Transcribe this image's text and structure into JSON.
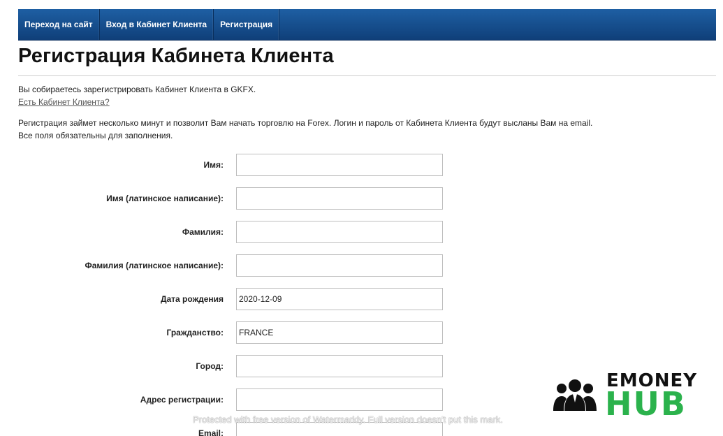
{
  "nav": {
    "items": [
      {
        "label": "Переход на сайт"
      },
      {
        "label": "Вход в Кабинет Клиента"
      },
      {
        "label": "Регистрация"
      }
    ]
  },
  "page": {
    "title": "Регистрация Кабинета Клиента",
    "intro": "Вы собираетесь зарегистрировать Кабинет Клиента в GKFX.",
    "have_account_link": "Есть Кабинет Клиента?",
    "info_line1": "Регистрация займет несколько минут и позволит Вам начать торговлю на Forex. Логин и пароль от Кабинета Клиента будут высланы Вам на email.",
    "info_line2": "Все поля обязательны для заполнения."
  },
  "form": {
    "fields": [
      {
        "label": "Имя:",
        "value": ""
      },
      {
        "label": "Имя (латинское написание):",
        "value": ""
      },
      {
        "label": "Фамилия:",
        "value": ""
      },
      {
        "label": "Фамилия (латинское написание):",
        "value": ""
      },
      {
        "label": "Дата рождения",
        "value": "2020-12-09"
      },
      {
        "label": "Гражданство:",
        "value": "FRANCE"
      },
      {
        "label": "Город:",
        "value": ""
      },
      {
        "label": "Адрес регистрации:",
        "value": ""
      },
      {
        "label": "Email:",
        "value": ""
      }
    ]
  },
  "logo": {
    "top_text": "EMONEY",
    "bottom_text": "HUB",
    "accent_color": "#2bb24c"
  },
  "watermark": {
    "text": "Protected with free version of Watermarkly. Full version doesn't put this mark."
  },
  "colors": {
    "nav_bg": "#1e5fa3",
    "nav_bg_dark": "#0f3f79"
  }
}
